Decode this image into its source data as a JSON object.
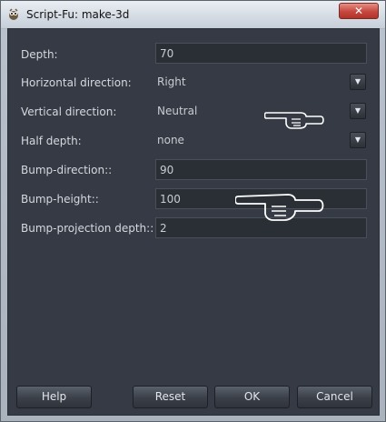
{
  "window": {
    "title": "Script-Fu: make-3d",
    "close_symbol": "✕",
    "icon": "gimp-app-icon"
  },
  "params": [
    {
      "label": "Depth:",
      "type": "text",
      "value": "70"
    },
    {
      "label": "Horizontal direction:",
      "type": "combo",
      "value": "Right"
    },
    {
      "label": "Vertical direction:",
      "type": "combo",
      "value": "Neutral"
    },
    {
      "label": "Half depth:",
      "type": "combo",
      "value": "none"
    },
    {
      "label": "Bump-direction::",
      "type": "text",
      "value": "90"
    },
    {
      "label": "Bump-height::",
      "type": "text",
      "value": "100"
    },
    {
      "label": "Bump-projection depth::",
      "type": "text",
      "value": "2"
    }
  ],
  "buttons": {
    "help_label": "Help",
    "reset_label": "Reset",
    "ok_label": "OK",
    "cancel_label": "Cancel"
  },
  "annotations": {
    "pointer_icon": "pointing-hand-icon"
  }
}
